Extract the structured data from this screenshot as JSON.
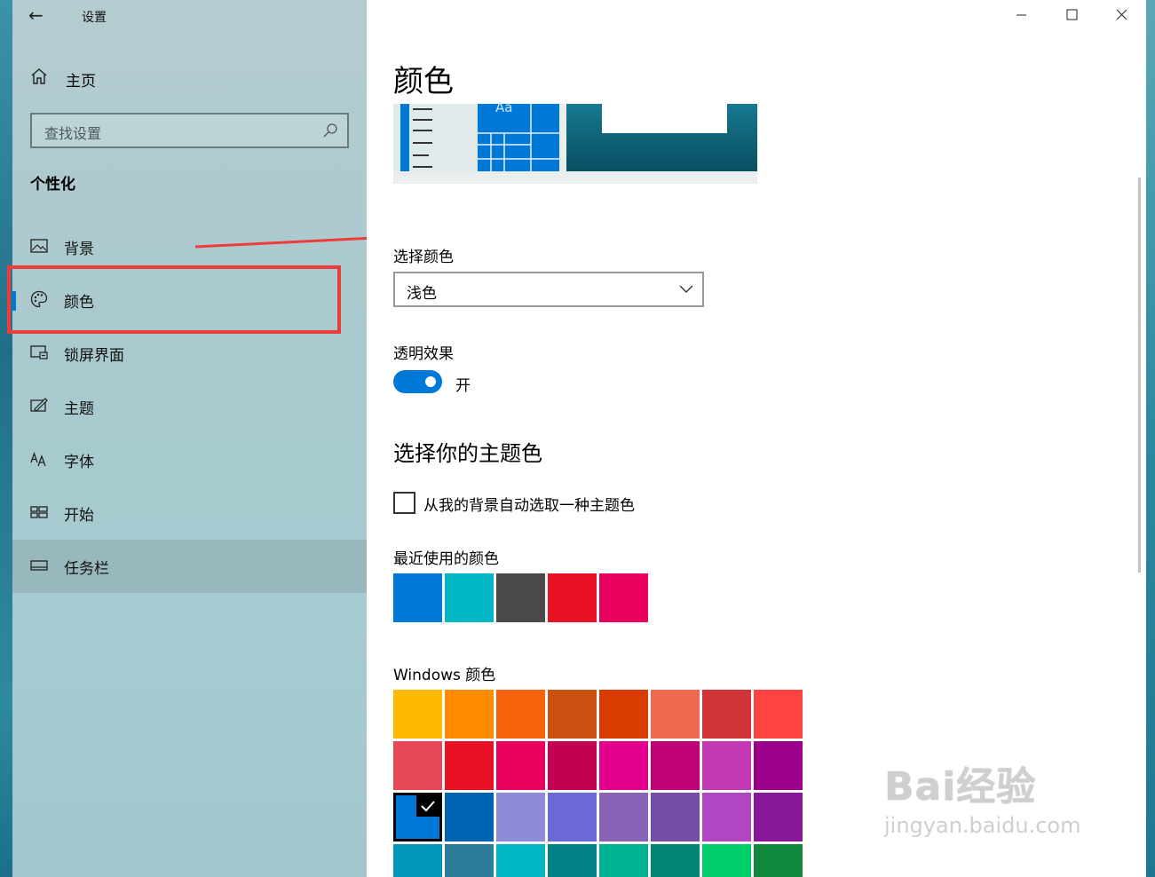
{
  "window": {
    "title": "设置"
  },
  "sidebar": {
    "home_label": "主页",
    "search_placeholder": "查找设置",
    "section": "个性化",
    "items": [
      {
        "label": "背景",
        "icon": "picture-icon"
      },
      {
        "label": "颜色",
        "icon": "palette-icon"
      },
      {
        "label": "锁屏界面",
        "icon": "lockscreen-icon"
      },
      {
        "label": "主题",
        "icon": "theme-icon"
      },
      {
        "label": "字体",
        "icon": "font-icon"
      },
      {
        "label": "开始",
        "icon": "start-icon"
      },
      {
        "label": "任务栏",
        "icon": "taskbar-icon"
      }
    ],
    "selected_index": 1
  },
  "main": {
    "title": "颜色",
    "preview_text": "Aa",
    "choose_color_label": "选择颜色",
    "choose_color_value": "浅色",
    "transparency_label": "透明效果",
    "transparency_state": "开",
    "accent_heading": "选择你的主题色",
    "auto_pick_label": "从我的背景自动选取一种主题色",
    "recent_label": "最近使用的颜色",
    "recent_colors": [
      "#0078d7",
      "#00b7c3",
      "#4c4a48",
      "#e81123",
      "#ea005e"
    ],
    "windows_colors_label": "Windows 颜色",
    "windows_colors": [
      [
        "#ffb900",
        "#ff8c00",
        "#f7630c",
        "#ca5010",
        "#da3b01",
        "#ef6950",
        "#d13438",
        "#ff4343"
      ],
      [
        "#e74856",
        "#e81123",
        "#ea005e",
        "#c30052",
        "#e3008c",
        "#bf0077",
        "#c239b3",
        "#9a0089"
      ],
      [
        "#0078d7",
        "#0063b1",
        "#8e8cd8",
        "#6b69d6",
        "#8764b8",
        "#744da9",
        "#b146c2",
        "#881798"
      ],
      [
        "#0099bc",
        "#2d7d9a",
        "#00b7c3",
        "#038387",
        "#00b294",
        "#018574",
        "#00cc6a",
        "#10893e"
      ]
    ],
    "selected_windows_color": "#0078d7"
  },
  "watermark": {
    "main": "Bai经验",
    "sub": "jingyan.baidu.com"
  }
}
